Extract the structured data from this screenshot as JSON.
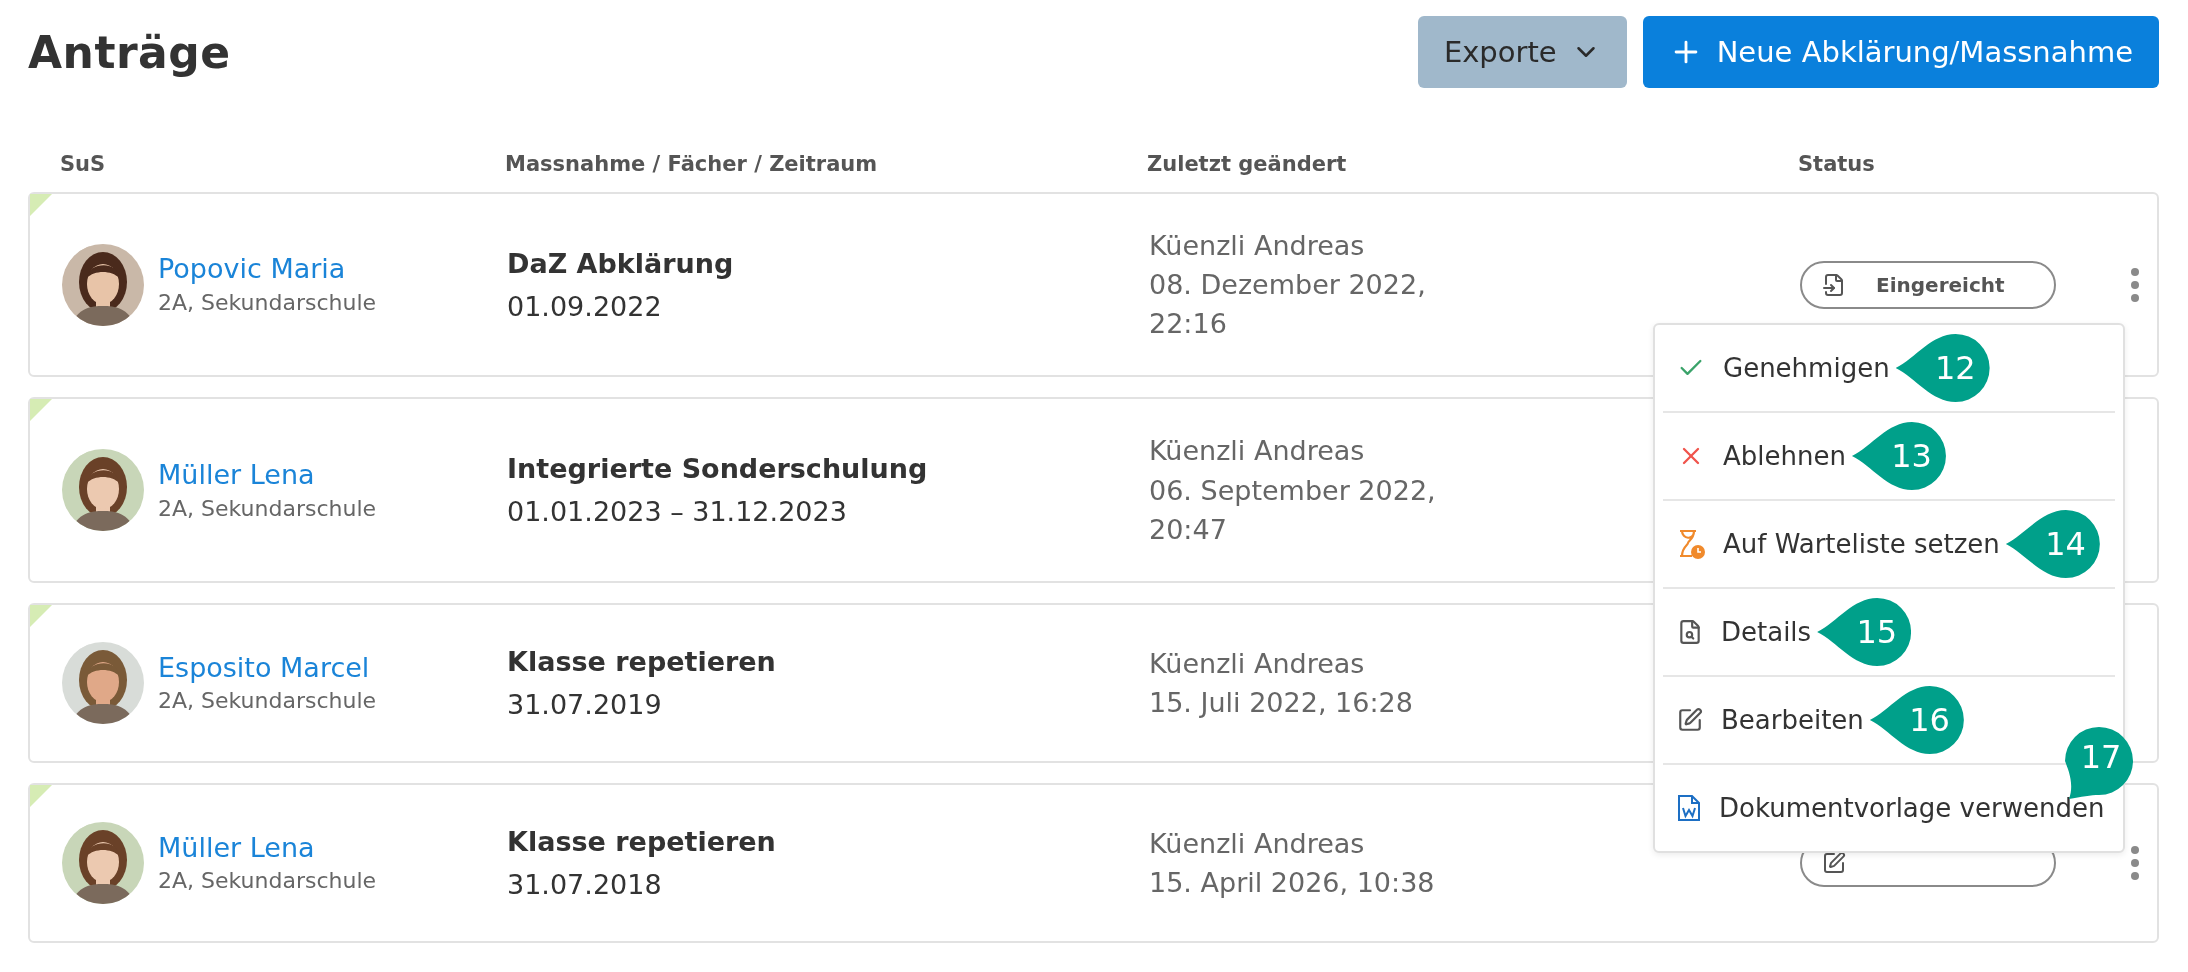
{
  "title": "Anträge",
  "actions": [
    {
      "kind": "dropdown",
      "label": "Exporte"
    },
    {
      "kind": "primary",
      "label": "Neue Abklärung/Massnahme"
    }
  ],
  "table": {
    "columns": [
      "SuS",
      "Massnahme / Fächer / Zeitraum",
      "Zuletzt geändert",
      "Status"
    ],
    "rows": [
      {
        "marked": true,
        "name": "Popovic Maria",
        "class": "2A, Sekundarschule",
        "measure": "DaZ Abklärung",
        "period": "01.09.2022",
        "author": "Küenzli Andreas",
        "changed": [
          "08. Dezember 2022,",
          "22:16"
        ],
        "status": {
          "kind": "submitted",
          "label": "Eingereicht"
        },
        "more_button": true
      },
      {
        "marked": true,
        "name": "Müller Lena",
        "class": "2A, Sekundarschule",
        "measure": "Integrierte Sonderschulung",
        "period": "01.01.2023 – 31.12.2023",
        "author": "Küenzli Andreas",
        "changed": [
          "06. September 2022,",
          "20:47"
        ]
      },
      {
        "marked": true,
        "name": "Esposito Marcel",
        "class": "2A, Sekundarschule",
        "measure": "Klasse repetieren",
        "period": "31.07.2019",
        "author": "Küenzli Andreas",
        "changed": [
          "15. Juli 2022, 16:28"
        ]
      },
      {
        "marked": true,
        "name": "Müller Lena",
        "class": "2A, Sekundarschule",
        "measure": "Klasse repetieren",
        "period": "31.07.2018",
        "author": "Küenzli Andreas",
        "changed": [
          "15. April 2026, 10:38"
        ],
        "status": {
          "kind": "adjustment"
        },
        "more_button": true
      }
    ]
  },
  "menu": {
    "items": [
      {
        "kind": "approve",
        "label": "Genehmigen",
        "callout": "12",
        "points_down": false
      },
      {
        "kind": "reject",
        "label": "Ablehnen",
        "callout": "13",
        "points_down": false
      },
      {
        "kind": "waitlist",
        "label": "Auf Warteliste setzen",
        "callout": "14",
        "points_down": false
      },
      {
        "kind": "details",
        "label": "Details",
        "callout": "15",
        "points_down": false
      },
      {
        "kind": "edit",
        "label": "Bearbeiten",
        "callout": "16",
        "points_down": false
      },
      {
        "kind": "template",
        "label": "Dokumentvorlage verwenden",
        "callout": "17",
        "points_down": true
      }
    ]
  }
}
